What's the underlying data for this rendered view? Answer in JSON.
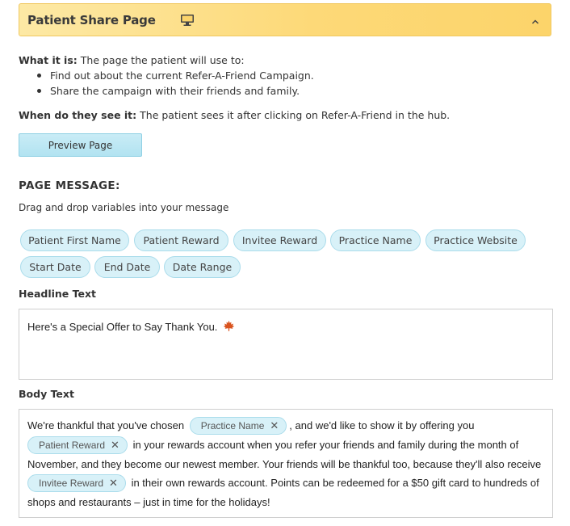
{
  "header": {
    "title": "Patient Share Page",
    "icon": "monitor-icon",
    "toggle_icon": "chevron-up-icon",
    "gradient_start": "#fde9a5",
    "gradient_end": "#fcd46a"
  },
  "info": {
    "what_label": "What it is:",
    "what_text": " The page the patient will use to:",
    "bullets": [
      "Find out about the current Refer-A-Friend Campaign.",
      "Share the campaign with their friends and family."
    ],
    "when_label": "When do they see it:",
    "when_text": " The patient sees it after clicking on Refer-A-Friend in the hub."
  },
  "preview_button": "Preview Page",
  "page_message": {
    "title": "PAGE MESSAGE:",
    "instructions": "Drag and drop variables into your message",
    "variables": [
      "Patient First Name",
      "Patient Reward",
      "Invitee Reward",
      "Practice Name",
      "Practice Website",
      "Start Date",
      "End Date",
      "Date Range"
    ]
  },
  "headline": {
    "label": "Headline Text",
    "text": "Here's a Special Offer to Say Thank You.",
    "emoji_icon": "maple-leaf-icon"
  },
  "body": {
    "label": "Body Text",
    "line1_a": "We're thankful that you've chosen",
    "chip_practice": "Practice Name",
    "line1_b": ", and we'd like to show it by offering you",
    "chip_patient_reward": "Patient Reward",
    "line2_b": "in your rewards account when you refer your friends and family during the month of",
    "line3": "November, and they become our newest member. Your friends will be thankful too, because they'll also receive",
    "chip_invitee_reward": "Invitee Reward",
    "line4_b": "in their own rewards account. Points can be redeemed for a $50 gift card to hundreds of",
    "line5": "shops and restaurants – just in time for the holidays!",
    "remove_glyph": "✕"
  },
  "colors": {
    "chip_bg": "#d8f1f8",
    "chip_border": "#aadceb",
    "button_bg": "#b2e3f1"
  }
}
